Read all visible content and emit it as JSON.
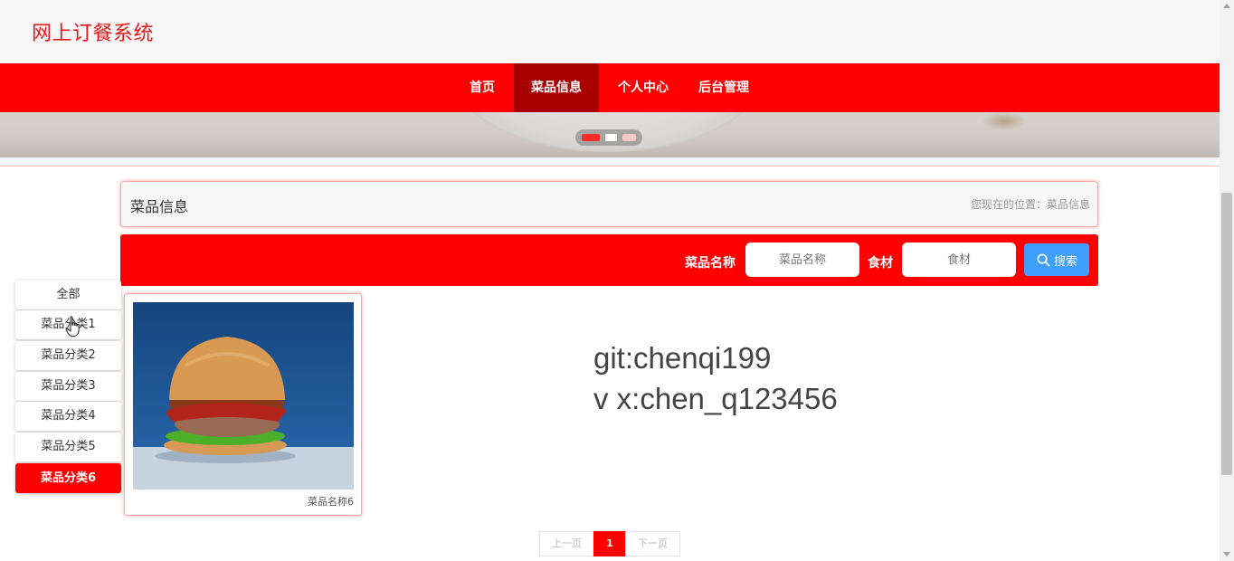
{
  "site": {
    "title": "网上订餐系统"
  },
  "nav": {
    "items": [
      "首页",
      "菜品信息",
      "个人中心",
      "后台管理"
    ],
    "active": "菜品信息"
  },
  "banner": {
    "slides": 3,
    "current_slide": 1
  },
  "section": {
    "title": "菜品信息",
    "location": "您现在的位置：菜品信息"
  },
  "search": {
    "name_label": "菜品名称",
    "name_placeholder": "菜品名称",
    "name_value": "",
    "ingredient_label": "食材",
    "ingredient_placeholder": "食材",
    "ingredient_value": "",
    "button_label": "搜索"
  },
  "categories": {
    "items": [
      "全部",
      "菜品分类1",
      "菜品分类2",
      "菜品分类3",
      "菜品分类4",
      "菜品分类5",
      "菜品分类6"
    ],
    "active": "菜品分类6"
  },
  "dishes": [
    {
      "name": "菜品名称6"
    }
  ],
  "watermark": {
    "line1": "git:chenqi199",
    "line2": "v x:chen_q123456"
  },
  "pagination": {
    "prev": "上一页",
    "current": "1",
    "next": "下一页"
  },
  "colors": {
    "brand_red": "#ff0000",
    "nav_active": "#a80000",
    "title_red": "#e8161a",
    "search_button": "#409eff"
  },
  "icons": {
    "search": "search-icon",
    "cursor": "hand-pointer-icon"
  }
}
